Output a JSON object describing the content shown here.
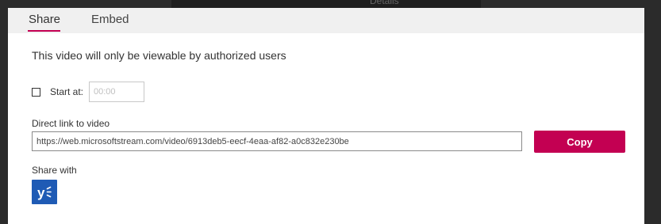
{
  "background": {
    "header_text": "Details"
  },
  "tabs": [
    {
      "label": "Share",
      "active": true
    },
    {
      "label": "Embed",
      "active": false
    }
  ],
  "share": {
    "info_text": "This video will only be viewable by authorized users",
    "start_at": {
      "label": "Start at:",
      "checked": false,
      "placeholder": "00:00",
      "value": ""
    },
    "direct_link": {
      "label": "Direct link to video",
      "value": "https://web.microsoftstream.com/video/6913deb5-eecf-4eaa-af82-a0c832e230be"
    },
    "copy_label": "Copy",
    "share_with": {
      "label": "Share with",
      "services": [
        {
          "name": "Yammer",
          "icon": "yammer-icon"
        }
      ]
    }
  },
  "colors": {
    "accent": "#c30052",
    "yammer": "#1f5bb5",
    "tabbar": "#f0f0f0",
    "backdrop": "#2b2b2b"
  }
}
